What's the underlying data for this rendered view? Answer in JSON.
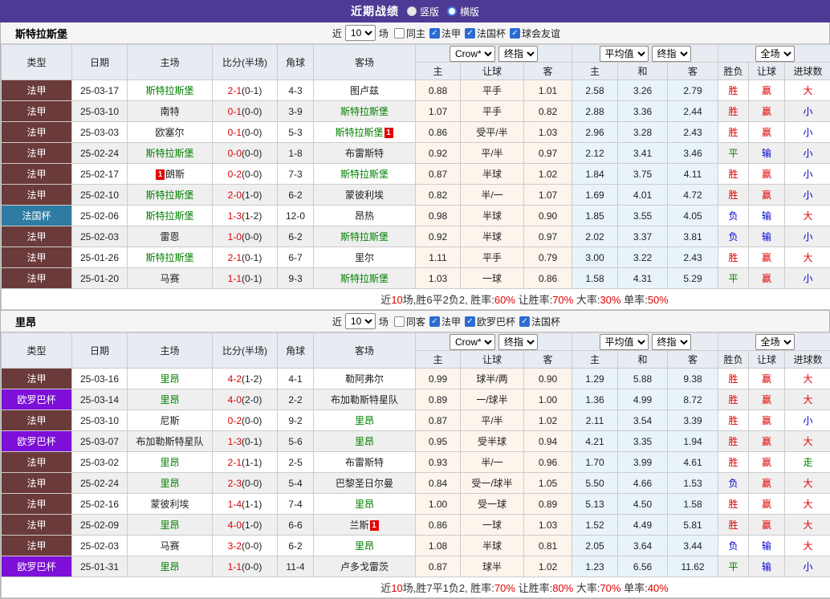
{
  "titlebar": {
    "title": "近期战绩",
    "options": [
      {
        "label": "竖版",
        "selected": true
      },
      {
        "label": "横版",
        "selected": false
      }
    ]
  },
  "columns": {
    "type": "类型",
    "date": "日期",
    "home": "主场",
    "score": "比分(半场)",
    "corner": "角球",
    "away": "客场",
    "odds_home": "主",
    "odds_handicap": "让球",
    "odds_away": "客",
    "avg_home": "主",
    "avg_draw": "和",
    "avg_away": "客",
    "result": "胜负",
    "handicap_result": "让球",
    "goals": "进球数"
  },
  "dropdowns": {
    "company": "Crow*",
    "company_period": "终指",
    "average": "平均值",
    "average_period": "终指",
    "scope": "全场"
  },
  "league_colors": {
    "法甲": "#6b3a3a",
    "法国杯": "#2e7ca3",
    "欧罗巴杯": "#7d0fd8"
  },
  "value_colors": {
    "胜": "#e00000",
    "平": "#008000",
    "负": "#0000cc",
    "赢": "#e00000",
    "输": "#0000cc",
    "大": "#e00000",
    "小": "#0000cc",
    "走": "#008000"
  },
  "sections": [
    {
      "team": "斯特拉斯堡",
      "filter": {
        "recent": "近",
        "count": "10",
        "unit": "场",
        "same": "同主",
        "same_checked": false,
        "leagues": [
          {
            "label": "法甲",
            "checked": true
          },
          {
            "label": "法国杯",
            "checked": true
          },
          {
            "label": "球会友谊",
            "checked": true
          }
        ]
      },
      "rows": [
        {
          "league": "法甲",
          "date": "25-03-17",
          "home": "斯特拉斯堡",
          "hs": true,
          "score": "2-1",
          "half": "(0-1)",
          "corner": "4-3",
          "away": "图卢兹",
          "crow": [
            "0.88",
            "平手",
            "1.01"
          ],
          "avg": [
            "2.58",
            "3.26",
            "2.79"
          ],
          "res": [
            "胜",
            "赢",
            "大"
          ]
        },
        {
          "league": "法甲",
          "date": "25-03-10",
          "home": "南特",
          "score": "0-1",
          "half": "(0-0)",
          "corner": "3-9",
          "away": "斯特拉斯堡",
          "as": true,
          "crow": [
            "1.07",
            "平手",
            "0.82"
          ],
          "avg": [
            "2.88",
            "3.36",
            "2.44"
          ],
          "res": [
            "胜",
            "赢",
            "小"
          ]
        },
        {
          "league": "法甲",
          "date": "25-03-03",
          "home": "欧塞尔",
          "score": "0-1",
          "half": "(0-0)",
          "corner": "5-3",
          "away": "斯特拉斯堡",
          "as": true,
          "away_card": "1",
          "away_card_pos": "after",
          "crow": [
            "0.86",
            "受平/半",
            "1.03"
          ],
          "avg": [
            "2.96",
            "3.28",
            "2.43"
          ],
          "res": [
            "胜",
            "赢",
            "小"
          ]
        },
        {
          "league": "法甲",
          "date": "25-02-24",
          "home": "斯特拉斯堡",
          "hs": true,
          "score": "0-0",
          "half": "(0-0)",
          "corner": "1-8",
          "away": "布雷斯特",
          "crow": [
            "0.92",
            "平/半",
            "0.97"
          ],
          "avg": [
            "2.12",
            "3.41",
            "3.46"
          ],
          "res": [
            "平",
            "输",
            "小"
          ]
        },
        {
          "league": "法甲",
          "date": "25-02-17",
          "home": "朗斯",
          "home_card": "1",
          "home_card_pos": "before",
          "score": "0-2",
          "half": "(0-0)",
          "corner": "7-3",
          "away": "斯特拉斯堡",
          "as": true,
          "crow": [
            "0.87",
            "半球",
            "1.02"
          ],
          "avg": [
            "1.84",
            "3.75",
            "4.11"
          ],
          "res": [
            "胜",
            "赢",
            "小"
          ]
        },
        {
          "league": "法甲",
          "date": "25-02-10",
          "home": "斯特拉斯堡",
          "hs": true,
          "score": "2-0",
          "half": "(1-0)",
          "corner": "6-2",
          "away": "蒙彼利埃",
          "crow": [
            "0.82",
            "半/一",
            "1.07"
          ],
          "avg": [
            "1.69",
            "4.01",
            "4.72"
          ],
          "res": [
            "胜",
            "赢",
            "小"
          ]
        },
        {
          "league": "法国杯",
          "date": "25-02-06",
          "home": "斯特拉斯堡",
          "hs": true,
          "score": "1-3",
          "half": "(1-2)",
          "corner": "12-0",
          "away": "昂热",
          "crow": [
            "0.98",
            "半球",
            "0.90"
          ],
          "avg": [
            "1.85",
            "3.55",
            "4.05"
          ],
          "res": [
            "负",
            "输",
            "大"
          ]
        },
        {
          "league": "法甲",
          "date": "25-02-03",
          "home": "雷恩",
          "score": "1-0",
          "half": "(0-0)",
          "corner": "6-2",
          "away": "斯特拉斯堡",
          "as": true,
          "crow": [
            "0.92",
            "半球",
            "0.97"
          ],
          "avg": [
            "2.02",
            "3.37",
            "3.81"
          ],
          "res": [
            "负",
            "输",
            "小"
          ]
        },
        {
          "league": "法甲",
          "date": "25-01-26",
          "home": "斯特拉斯堡",
          "hs": true,
          "score": "2-1",
          "half": "(0-1)",
          "corner": "6-7",
          "away": "里尔",
          "crow": [
            "1.11",
            "平手",
            "0.79"
          ],
          "avg": [
            "3.00",
            "3.22",
            "2.43"
          ],
          "res": [
            "胜",
            "赢",
            "大"
          ]
        },
        {
          "league": "法甲",
          "date": "25-01-20",
          "home": "马赛",
          "score": "1-1",
          "half": "(0-1)",
          "corner": "9-3",
          "away": "斯特拉斯堡",
          "as": true,
          "crow": [
            "1.03",
            "一球",
            "0.86"
          ],
          "avg": [
            "1.58",
            "4.31",
            "5.29"
          ],
          "res": [
            "平",
            "赢",
            "小"
          ]
        }
      ],
      "summary": [
        {
          "t": "近"
        },
        {
          "t": "10",
          "r": true
        },
        {
          "t": "场,胜6平2负2, 胜率:"
        },
        {
          "t": "60%",
          "r": true
        },
        {
          "t": " 让胜率:"
        },
        {
          "t": "70%",
          "r": true
        },
        {
          "t": " 大率:"
        },
        {
          "t": "30%",
          "r": true
        },
        {
          "t": " 单率:"
        },
        {
          "t": "50%",
          "r": true
        }
      ]
    },
    {
      "team": "里昂",
      "filter": {
        "recent": "近",
        "count": "10",
        "unit": "场",
        "same": "同客",
        "same_checked": false,
        "leagues": [
          {
            "label": "法甲",
            "checked": true
          },
          {
            "label": "欧罗巴杯",
            "checked": true
          },
          {
            "label": "法国杯",
            "checked": true
          }
        ]
      },
      "rows": [
        {
          "league": "法甲",
          "date": "25-03-16",
          "home": "里昂",
          "hs": true,
          "score": "4-2",
          "half": "(1-2)",
          "corner": "4-1",
          "away": "勒阿弗尔",
          "crow": [
            "0.99",
            "球半/两",
            "0.90"
          ],
          "avg": [
            "1.29",
            "5.88",
            "9.38"
          ],
          "res": [
            "胜",
            "赢",
            "大"
          ]
        },
        {
          "league": "欧罗巴杯",
          "date": "25-03-14",
          "home": "里昂",
          "hs": true,
          "score": "4-0",
          "half": "(2-0)",
          "corner": "2-2",
          "away": "布加勒斯特星队",
          "crow": [
            "0.89",
            "一/球半",
            "1.00"
          ],
          "avg": [
            "1.36",
            "4.99",
            "8.72"
          ],
          "res": [
            "胜",
            "赢",
            "大"
          ]
        },
        {
          "league": "法甲",
          "date": "25-03-10",
          "home": "尼斯",
          "score": "0-2",
          "half": "(0-0)",
          "corner": "9-2",
          "away": "里昂",
          "as": true,
          "crow": [
            "0.87",
            "平/半",
            "1.02"
          ],
          "avg": [
            "2.11",
            "3.54",
            "3.39"
          ],
          "res": [
            "胜",
            "赢",
            "小"
          ]
        },
        {
          "league": "欧罗巴杯",
          "date": "25-03-07",
          "home": "布加勒斯特星队",
          "score": "1-3",
          "half": "(0-1)",
          "corner": "5-6",
          "away": "里昂",
          "as": true,
          "crow": [
            "0.95",
            "受半球",
            "0.94"
          ],
          "avg": [
            "4.21",
            "3.35",
            "1.94"
          ],
          "res": [
            "胜",
            "赢",
            "大"
          ]
        },
        {
          "league": "法甲",
          "date": "25-03-02",
          "home": "里昂",
          "hs": true,
          "score": "2-1",
          "half": "(1-1)",
          "corner": "2-5",
          "away": "布雷斯特",
          "crow": [
            "0.93",
            "半/一",
            "0.96"
          ],
          "avg": [
            "1.70",
            "3.99",
            "4.61"
          ],
          "res": [
            "胜",
            "赢",
            "走"
          ]
        },
        {
          "league": "法甲",
          "date": "25-02-24",
          "home": "里昂",
          "hs": true,
          "score": "2-3",
          "half": "(0-0)",
          "corner": "5-4",
          "away": "巴黎圣日尔曼",
          "crow": [
            "0.84",
            "受一/球半",
            "1.05"
          ],
          "avg": [
            "5.50",
            "4.66",
            "1.53"
          ],
          "res": [
            "负",
            "赢",
            "大"
          ]
        },
        {
          "league": "法甲",
          "date": "25-02-16",
          "home": "蒙彼利埃",
          "score": "1-4",
          "half": "(1-1)",
          "corner": "7-4",
          "away": "里昂",
          "as": true,
          "crow": [
            "1.00",
            "受一球",
            "0.89"
          ],
          "avg": [
            "5.13",
            "4.50",
            "1.58"
          ],
          "res": [
            "胜",
            "赢",
            "大"
          ]
        },
        {
          "league": "法甲",
          "date": "25-02-09",
          "home": "里昂",
          "hs": true,
          "score": "4-0",
          "half": "(1-0)",
          "corner": "6-6",
          "away": "兰斯",
          "away_card": "1",
          "away_card_pos": "after",
          "crow": [
            "0.86",
            "一球",
            "1.03"
          ],
          "avg": [
            "1.52",
            "4.49",
            "5.81"
          ],
          "res": [
            "胜",
            "赢",
            "大"
          ]
        },
        {
          "league": "法甲",
          "date": "25-02-03",
          "home": "马赛",
          "score": "3-2",
          "half": "(0-0)",
          "corner": "6-2",
          "away": "里昂",
          "as": true,
          "crow": [
            "1.08",
            "半球",
            "0.81"
          ],
          "avg": [
            "2.05",
            "3.64",
            "3.44"
          ],
          "res": [
            "负",
            "输",
            "大"
          ]
        },
        {
          "league": "欧罗巴杯",
          "date": "25-01-31",
          "home": "里昂",
          "hs": true,
          "score": "1-1",
          "half": "(0-0)",
          "corner": "11-4",
          "away": "卢多戈雷茨",
          "crow": [
            "0.87",
            "球半",
            "1.02"
          ],
          "avg": [
            "1.23",
            "6.56",
            "11.62"
          ],
          "res": [
            "平",
            "输",
            "小"
          ]
        }
      ],
      "summary": [
        {
          "t": "近"
        },
        {
          "t": "10",
          "r": true
        },
        {
          "t": "场,胜7平1负2, 胜率:"
        },
        {
          "t": "70%",
          "r": true
        },
        {
          "t": " 让胜率:"
        },
        {
          "t": "80%",
          "r": true
        },
        {
          "t": " 大率:"
        },
        {
          "t": "70%",
          "r": true
        },
        {
          "t": " 单率:"
        },
        {
          "t": "40%",
          "r": true
        }
      ]
    }
  ]
}
